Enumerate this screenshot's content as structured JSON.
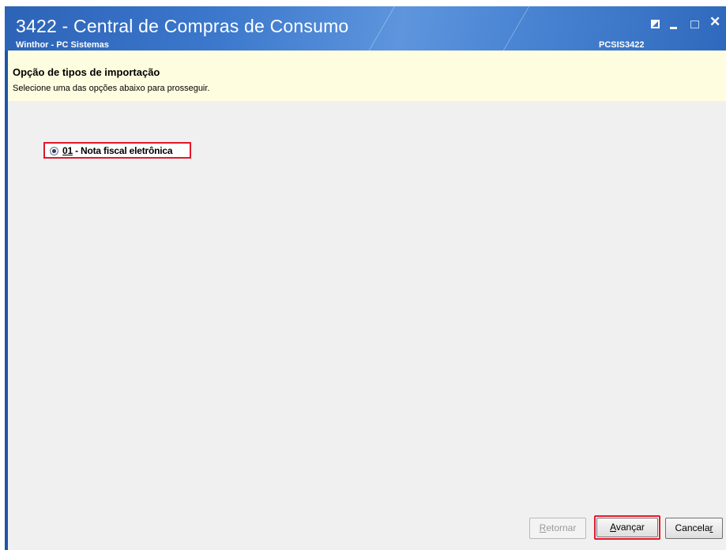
{
  "window": {
    "title": "3422 - Central de Compras de Consumo",
    "subtitle": "Winthor - PC Sistemas",
    "code": "PCSIS3422",
    "controls": [
      "restore-icon",
      "minimize-icon",
      "maximize-icon",
      "close-icon"
    ]
  },
  "header": {
    "title": "Opção de tipos de importação",
    "subtitle": "Selecione uma das opções abaixo para prosseguir."
  },
  "options": [
    {
      "prefix": "01",
      "label": " - Nota fiscal eletrônica",
      "selected": true
    }
  ],
  "buttons": {
    "back": {
      "pre": "",
      "accel": "R",
      "post": "etornar",
      "enabled": false
    },
    "next": {
      "pre": "",
      "accel": "A",
      "post": "vançar",
      "enabled": true
    },
    "cancel": {
      "pre": "Cancela",
      "accel": "r",
      "post": "",
      "enabled": true
    }
  },
  "colors": {
    "titlebar": "#3c78cc",
    "header_band": "#fffde0",
    "highlight": "#e0182a",
    "client_bg": "#f0f0f0"
  }
}
